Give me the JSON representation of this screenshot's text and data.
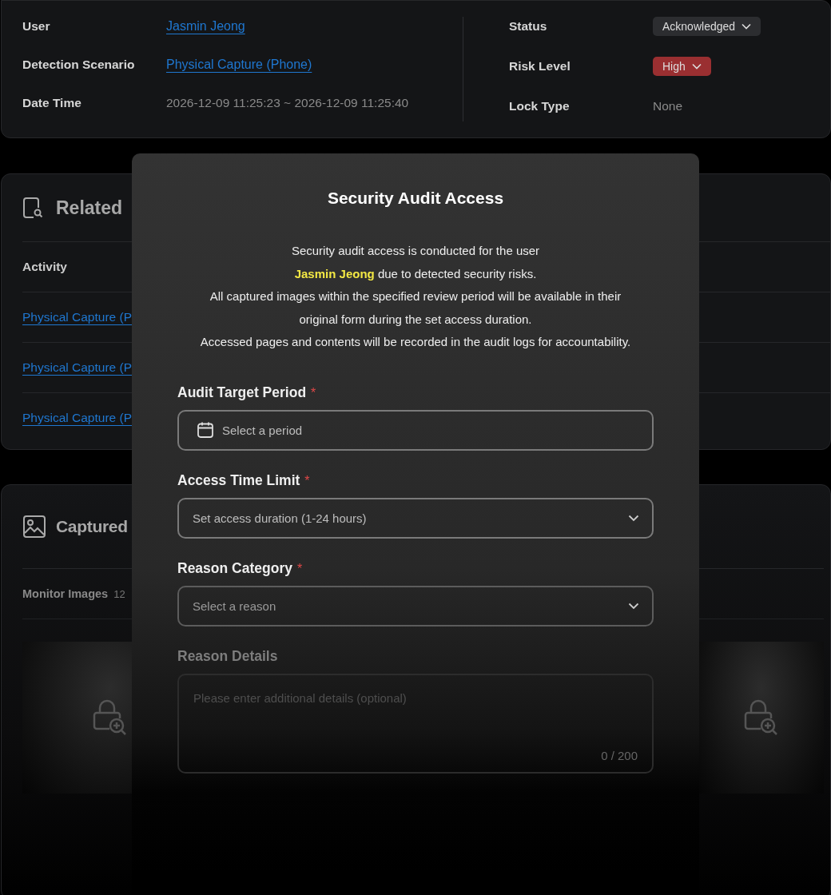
{
  "detail": {
    "left": [
      {
        "label": "User",
        "value": "Jasmin Jeong",
        "kind": "link"
      },
      {
        "label": "Detection Scenario",
        "value": "Physical Capture (Phone)",
        "kind": "link"
      },
      {
        "label": "Date Time",
        "value": "2026-12-09 11:25:23 ~ 2026-12-09 11:25:40",
        "kind": "text"
      }
    ],
    "right": [
      {
        "label": "Status",
        "value": "Acknowledged",
        "kind": "dropdown",
        "color": "#2c2d30"
      },
      {
        "label": "Risk Level",
        "value": "High",
        "kind": "dropdown",
        "color": "#9a2f31"
      },
      {
        "label": "Lock Type",
        "value": "None",
        "kind": "text"
      }
    ]
  },
  "related": {
    "title": "Related",
    "column_1": "Activity",
    "rows": [
      "Physical Capture (P",
      "Physical Capture (P",
      "Physical Capture (P"
    ]
  },
  "captured": {
    "title": "Captured",
    "tab_label": "Monitor Images",
    "count": "12"
  },
  "modal": {
    "title": "Security Audit Access",
    "description": [
      "Security audit access is conducted for the user",
      "**Jasmin Jeong** due to detected security risks.",
      "All captured images within the specified review period will be available in their",
      "original form during the set access duration.",
      "Accessed pages and contents will be recorded in the audit logs for accountability."
    ],
    "fields": [
      {
        "label": "Audit Target Period",
        "required_mark": "*",
        "kind": "date",
        "placeholder": "Select a period"
      },
      {
        "label": "Access Time Limit",
        "required_mark": "*",
        "kind": "select",
        "placeholder": "Set access duration (1-24 hours)"
      },
      {
        "label": "Reason Category",
        "required_mark": "*",
        "kind": "select",
        "placeholder": "Select a reason"
      },
      {
        "label": "Reason Details",
        "kind": "textarea",
        "placeholder": "Please enter additional details (optional)",
        "counter": "0 / 200"
      }
    ]
  }
}
